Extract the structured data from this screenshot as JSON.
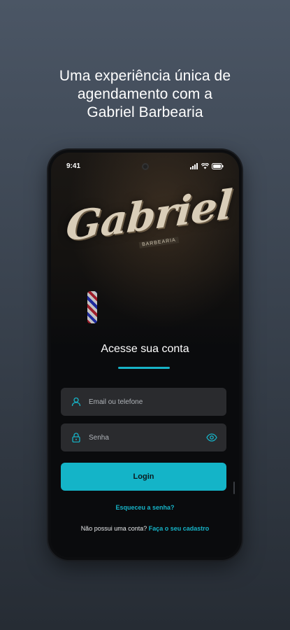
{
  "headline": {
    "line1": "Uma experiência única de",
    "line2": "agendamento com a",
    "line3": "Gabriel Barbearia"
  },
  "status_bar": {
    "time": "9:41"
  },
  "logo": {
    "text": "Gabriel",
    "subtext": "BARBEARIA"
  },
  "login": {
    "title": "Acesse sua conta",
    "email_placeholder": "Email ou telefone",
    "password_placeholder": "Senha",
    "button_label": "Login",
    "forgot_label": "Esqueceu a senha?",
    "no_account_label": "Não possui uma conta?",
    "signup_link": "Faça o seu cadastro"
  },
  "icons": {
    "user": "user-icon",
    "lock": "lock-icon",
    "eye": "eye-icon",
    "signal": "signal-icon",
    "wifi": "wifi-icon",
    "battery": "battery-icon"
  },
  "colors": {
    "accent": "#14b4c8",
    "field_bg": "#2a2b2e",
    "screen_bg": "#0a0b0d"
  }
}
